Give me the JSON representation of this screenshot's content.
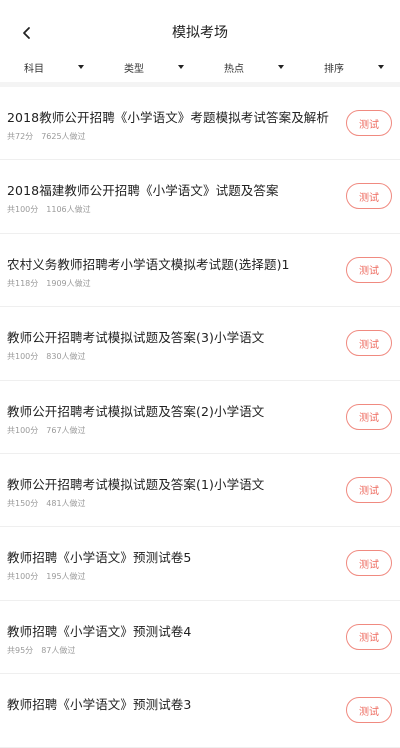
{
  "header": {
    "title": "模拟考场"
  },
  "filters": [
    {
      "label": "科目"
    },
    {
      "label": "类型"
    },
    {
      "label": "热点"
    },
    {
      "label": "排序"
    }
  ],
  "items": [
    {
      "title": "2018教师公开招聘《小学语文》考题模拟考试答案及解析",
      "score": "共72分",
      "count": "7625人做过",
      "button": "测试"
    },
    {
      "title": "2018福建教师公开招聘《小学语文》试题及答案",
      "score": "共100分",
      "count": "1106人做过",
      "button": "测试"
    },
    {
      "title": "农村义务教师招聘考小学语文模拟考试题(选择题)1",
      "score": "共118分",
      "count": "1909人做过",
      "button": "测试"
    },
    {
      "title": "教师公开招聘考试模拟试题及答案(3)小学语文",
      "score": "共100分",
      "count": "830人做过",
      "button": "测试"
    },
    {
      "title": "教师公开招聘考试模拟试题及答案(2)小学语文",
      "score": "共100分",
      "count": "767人做过",
      "button": "测试"
    },
    {
      "title": "教师公开招聘考试模拟试题及答案(1)小学语文",
      "score": "共150分",
      "count": "481人做过",
      "button": "测试"
    },
    {
      "title": "教师招聘《小学语文》预测试卷5",
      "score": "共100分",
      "count": "195人做过",
      "button": "测试"
    },
    {
      "title": "教师招聘《小学语文》预测试卷4",
      "score": "共95分",
      "count": "87人做过",
      "button": "测试"
    },
    {
      "title": "教师招聘《小学语文》预测试卷3",
      "score": "",
      "count": "",
      "button": "测试"
    }
  ]
}
